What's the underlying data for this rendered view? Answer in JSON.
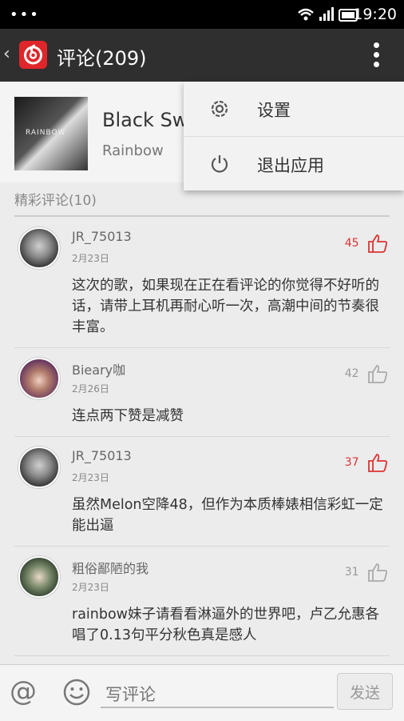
{
  "status_bar": {
    "dots": "•••",
    "time": "19:20"
  },
  "app_bar": {
    "back": "‹",
    "title": "评论(209)"
  },
  "song": {
    "title": "Black Swan",
    "artist": "Rainbow",
    "cover_text": "RAINBOW"
  },
  "section": {
    "label": "精彩评论(10)"
  },
  "comments": [
    {
      "user": "JR_75013",
      "date": "2月23日",
      "likes": "45",
      "liked": true,
      "text": "这次的歌，如果现在正在看评论的你觉得不好听的话，请带上耳机再耐心听一次，高潮中间的节奏很丰富。"
    },
    {
      "user": "Bieary咖",
      "date": "2月26日",
      "likes": "42",
      "liked": false,
      "text": "连点两下赞是减赞"
    },
    {
      "user": "JR_75013",
      "date": "2月23日",
      "likes": "37",
      "liked": true,
      "text": "虽然Melon空降48，但作为本质棒婊相信彩虹一定能出逼"
    },
    {
      "user": "粗俗鄙陋的我",
      "date": "2月23日",
      "likes": "31",
      "liked": false,
      "text": "rainbow妹子请看看淋逼外的世界吧，卢乙允惠各唱了0.13句平分秋色真是感人"
    }
  ],
  "menu": {
    "items": [
      {
        "label": "设置",
        "icon": "gear-icon"
      },
      {
        "label": "退出应用",
        "icon": "power-icon"
      }
    ]
  },
  "bottom_bar": {
    "at": "@",
    "placeholder": "写评论",
    "send": "发送"
  },
  "colors": {
    "app_bar": "#2f2f2f",
    "logo_red": "#e0262a",
    "like_red": "#dd3333"
  }
}
